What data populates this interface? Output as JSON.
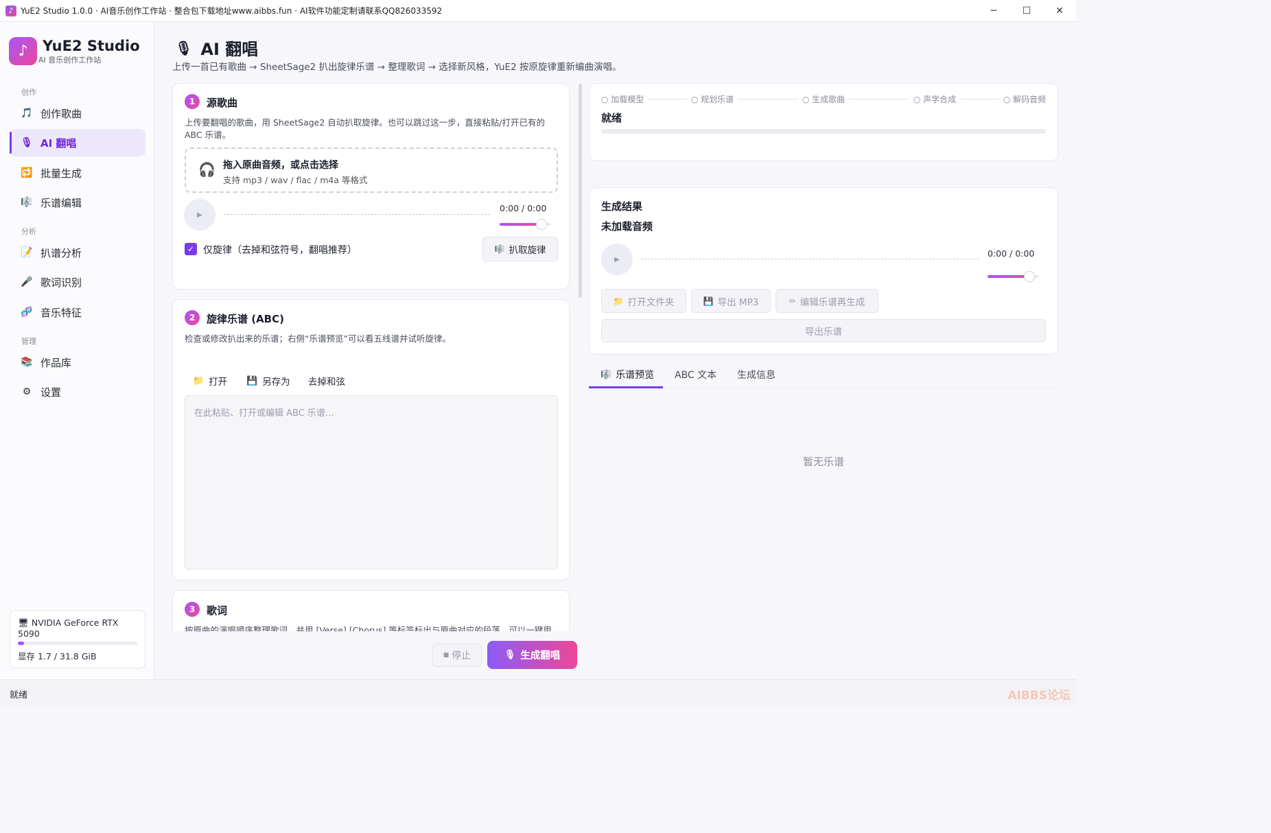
{
  "window": {
    "title": "YuE2 Studio 1.0.0 · AI音乐创作工作站 · 整合包下载地址www.aibbs.fun · AI软件功能定制请联系QQ826033592",
    "app_icon": "♪",
    "controls": {
      "minimize": "─",
      "maximize": "☐",
      "close": "✕"
    }
  },
  "sidebar": {
    "brand_name": "YuE2 Studio",
    "brand_sub": "AI 音乐创作工作站",
    "logo_glyph": "♪",
    "sections": {
      "create": "创作",
      "analyze": "分析",
      "manage": "管理"
    },
    "items": [
      {
        "label": "创作歌曲",
        "icon": "🎵"
      },
      {
        "label": "AI 翻唱",
        "icon": "🎙"
      },
      {
        "label": "批量生成",
        "icon": "🔁"
      },
      {
        "label": "乐谱编辑",
        "icon": "🎼"
      },
      {
        "label": "扒谱分析",
        "icon": "📝"
      },
      {
        "label": "歌词识别",
        "icon": "🎤"
      },
      {
        "label": "音乐特征",
        "icon": "🧬"
      },
      {
        "label": "作品库",
        "icon": "📚"
      },
      {
        "label": "设置",
        "icon": "⚙"
      }
    ],
    "gpu": {
      "name": "NVIDIA GeForce RTX 5090",
      "memory": "显存 1.7 / 31.8 GiB",
      "usage_fraction": 0.05
    }
  },
  "header": {
    "title": "AI 翻唱",
    "icon": "🎙",
    "description": "上传一首已有歌曲 → SheetSage2 扒出旋律乐谱 → 整理歌词 → 选择新风格，YuE2 按原旋律重新编曲演唱。"
  },
  "step1": {
    "num": "1",
    "title": "源歌曲",
    "desc": "上传要翻唱的歌曲，用 SheetSage2 自动扒取旋律。也可以跳过这一步，直接粘贴/打开已有的 ABC 乐谱。",
    "drop_main": "拖入原曲音频，或点击选择",
    "drop_sub": "支持 mp3 / wav / flac / m4a 等格式",
    "time": "0:00 / 0:00",
    "volume_fraction": 0.82,
    "melody_only_label": "仅旋律（去掉和弦符号，翻唱推荐）",
    "melody_only_checked": true,
    "extract_button": "扒取旋律"
  },
  "step2": {
    "num": "2",
    "title": "旋律乐谱 (ABC)",
    "desc": "检查或修改扒出来的乐谱；右侧“乐谱预览”可以看五线谱并试听旋律。",
    "open": "打开",
    "save_as": "另存为",
    "strip_chords": "去掉和弦",
    "placeholder": "在此粘贴、打开或编辑  ABC  乐谱..."
  },
  "step3": {
    "num": "3",
    "title": "歌词",
    "desc": "按原曲的演唱顺序整理歌词，并用 [Verse] [Chorus] 等标签标出与原曲对应的段落，可以一键用"
  },
  "progress": {
    "stages": [
      "加载模型",
      "规划乐谱",
      "生成歌曲",
      "声学合成",
      "解码音频"
    ],
    "status": "就绪",
    "fraction": 0
  },
  "result": {
    "title": "生成结果",
    "audio_status": "未加载音频",
    "time": "0:00 / 0:00",
    "volume_fraction": 0.82,
    "open_folder": "打开文件夹",
    "export_mp3": "导出 MP3",
    "edit_regen": "编辑乐谱再生成",
    "export_score": "导出乐谱"
  },
  "tabs": {
    "items": [
      "乐谱预览",
      "ABC 文本",
      "生成信息"
    ],
    "active": "乐谱预览",
    "empty": "暂无乐谱"
  },
  "actions": {
    "stop": "停止",
    "stop_icon": "■",
    "generate": "生成翻唱"
  },
  "statusbar": {
    "text": "就绪"
  }
}
